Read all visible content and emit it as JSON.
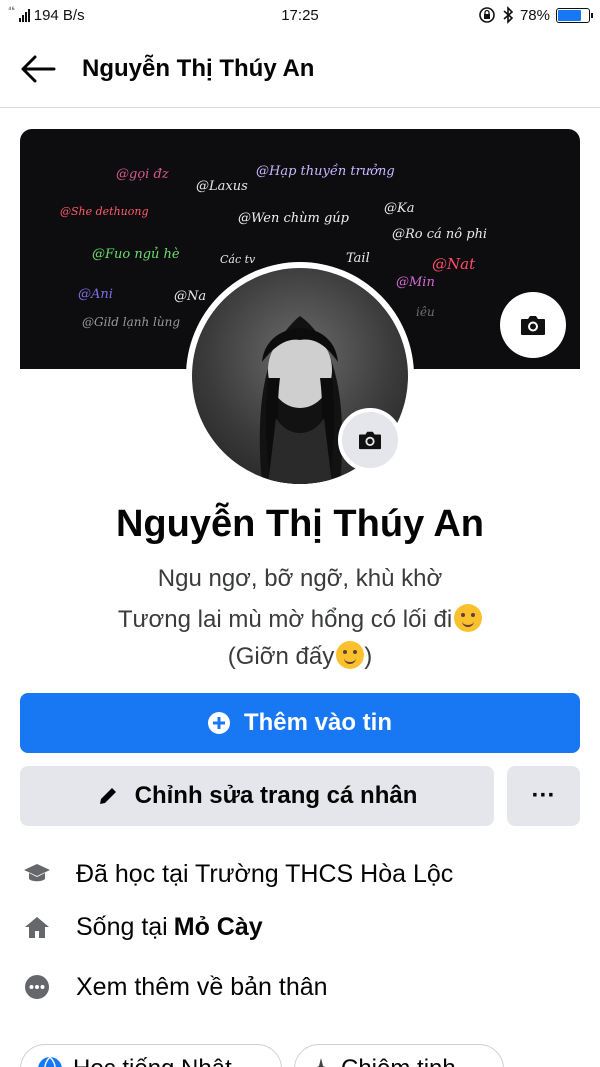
{
  "status_bar": {
    "network": "⁴⁶",
    "speed": "194 B/s",
    "time": "17:25",
    "battery": "78%",
    "battery_level": 0.78
  },
  "header": {
    "title": "Nguyễn Thị Thúy An"
  },
  "cover": {
    "texts": [
      "@gọi đz",
      "@Laxus",
      "@Hạp thuyền trưởng",
      "@She dethuong",
      "@Wen chùm gúp",
      "@Ka",
      "@Ro cá nô phi",
      "@Fuo ngủ hè",
      "Các tv",
      "Tail",
      "@Nat",
      "@Min",
      "@Ani",
      "@Na",
      "@Gild lạnh lùng",
      "iêu"
    ]
  },
  "profile": {
    "name": "Nguyễn Thị Thúy An",
    "bio_line1": "Ngu ngơ, bỡ ngỡ, khù khờ",
    "bio_line2": "Tương lai mù mờ hổng có lối đi",
    "bio_line3_a": "(Giỡn đấy",
    "bio_line3_b": ")"
  },
  "actions": {
    "add_story": "Thêm vào tin",
    "edit_profile": "Chỉnh sửa trang cá nhân",
    "more": "···"
  },
  "details": {
    "education": "Đã học tại Trường THCS Hòa Lộc",
    "lives_prefix": "Sống tại",
    "lives_place": "Mỏ Cày",
    "see_more": "Xem thêm về bản thân"
  },
  "chips": {
    "chip1": "Học tiếng Nhật",
    "chip2": "Chiêm tinh"
  },
  "colors": {
    "primary": "#1877f2",
    "secondary_bg": "#e4e6eb",
    "text": "#050505",
    "bio": "#3a3b3c"
  }
}
